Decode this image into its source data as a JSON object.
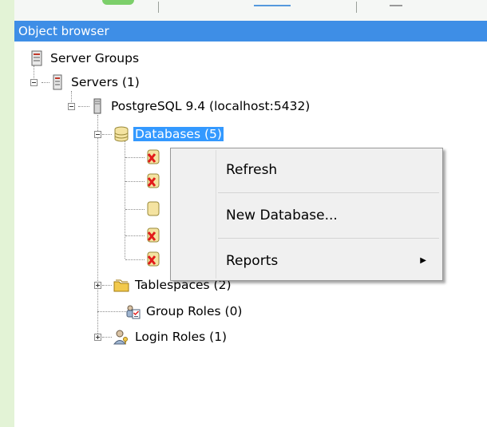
{
  "panel": {
    "title": "Object browser"
  },
  "tree": {
    "server_groups": "Server Groups",
    "servers": "Servers (1)",
    "postgres": "PostgreSQL 9.4 (localhost:5432)",
    "databases": "Databases (5)",
    "tablespaces": "Tablespaces (2)",
    "group_roles": "Group Roles (0)",
    "login_roles": "Login Roles (1)"
  },
  "context_menu": {
    "items": [
      {
        "label": "Refresh"
      },
      {
        "label": "New Database..."
      },
      {
        "label": "Reports",
        "has_submenu": true
      }
    ]
  },
  "colors": {
    "title_bar": "#3e8ee6",
    "selection": "#3399ff",
    "menu_bg": "#f0f0f0",
    "outer_bg": "#e3f3d6"
  },
  "icons": {
    "server_groups": "server-group-icon",
    "servers": "server-icon",
    "postgres": "postgres-server-icon",
    "databases": "databases-icon",
    "database_disconnected": "database-disconnected-icon",
    "database_connected": "database-icon",
    "tablespaces": "tablespaces-icon",
    "group_roles": "group-roles-icon",
    "login_roles": "login-roles-icon",
    "submenu_arrow": "chevron-right-icon"
  }
}
